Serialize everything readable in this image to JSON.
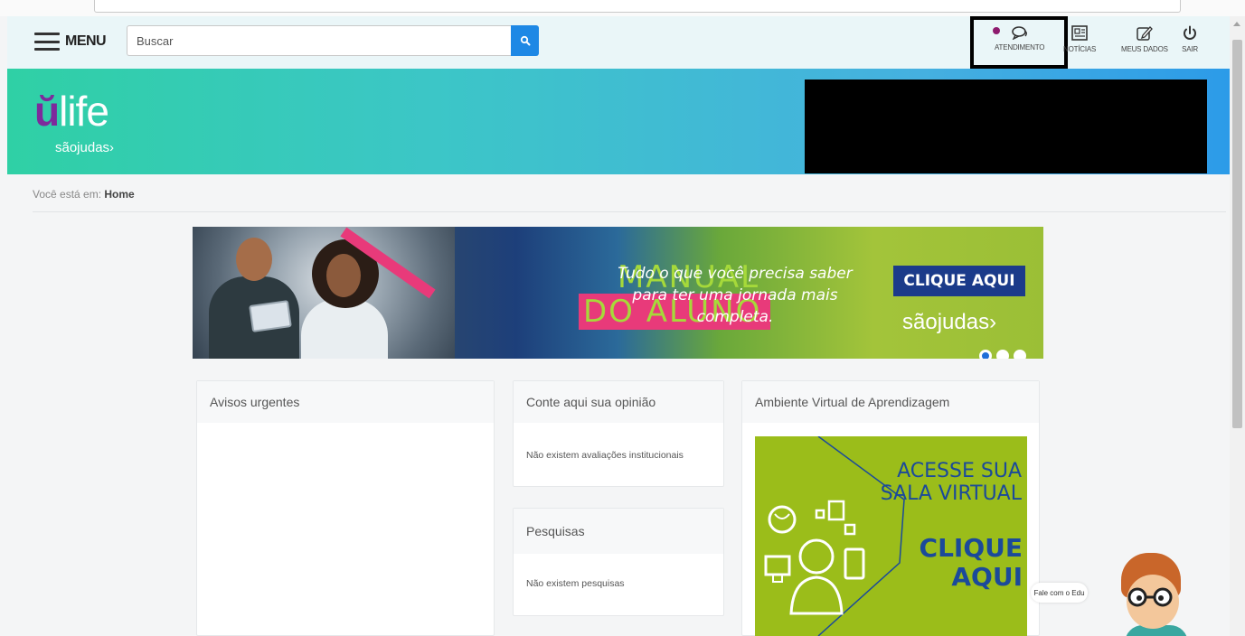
{
  "header": {
    "menu_label": "MENU",
    "search_placeholder": "Buscar",
    "icons": [
      {
        "name": "atendimento",
        "label": "ATENDIMENTO",
        "icon": "chat-bubbles-icon"
      },
      {
        "name": "noticias",
        "label": "NOTÍCIAS",
        "icon": "newspaper-icon"
      },
      {
        "name": "meus-dados",
        "label": "MEUS DADOS",
        "icon": "edit-icon"
      },
      {
        "name": "sair",
        "label": "SAIR",
        "icon": "power-icon"
      }
    ],
    "notification_color": "#8e1b6e"
  },
  "brand": {
    "logo_main": "life",
    "logo_u": "ŭ",
    "logo_sub": "sãojudas›"
  },
  "breadcrumb": {
    "prefix": "Você está em:",
    "current": "Home"
  },
  "promo": {
    "title_line1": "MANUAL",
    "title_line2": "DO ALUNO",
    "tagline": "Tudo o que você precisa saber para ter uma jornada mais completa.",
    "cta": "CLIQUE AQUI",
    "brand": "sãojudas›",
    "slides_total": 3,
    "slide_active": 1
  },
  "cards": {
    "avisos": {
      "title": "Avisos urgentes"
    },
    "opiniao": {
      "title": "Conte aqui sua opinião",
      "empty_text": "Não existem avaliações institucionais"
    },
    "pesquisas": {
      "title": "Pesquisas",
      "empty_text": "Não existem pesquisas"
    },
    "ava": {
      "title": "Ambiente Virtual de Aprendizagem",
      "line1": "ACESSE SUA",
      "line2": "SALA VIRTUAL",
      "cta1": "CLIQUE",
      "cta2": "AQUI"
    }
  },
  "chatbot": {
    "bubble": "Fale com o Edu"
  },
  "colors": {
    "accent": "#1e88e5",
    "brand_purple": "#7d2a9c",
    "ava_green": "#9bbd1a",
    "ava_blue": "#1b4a9a"
  }
}
